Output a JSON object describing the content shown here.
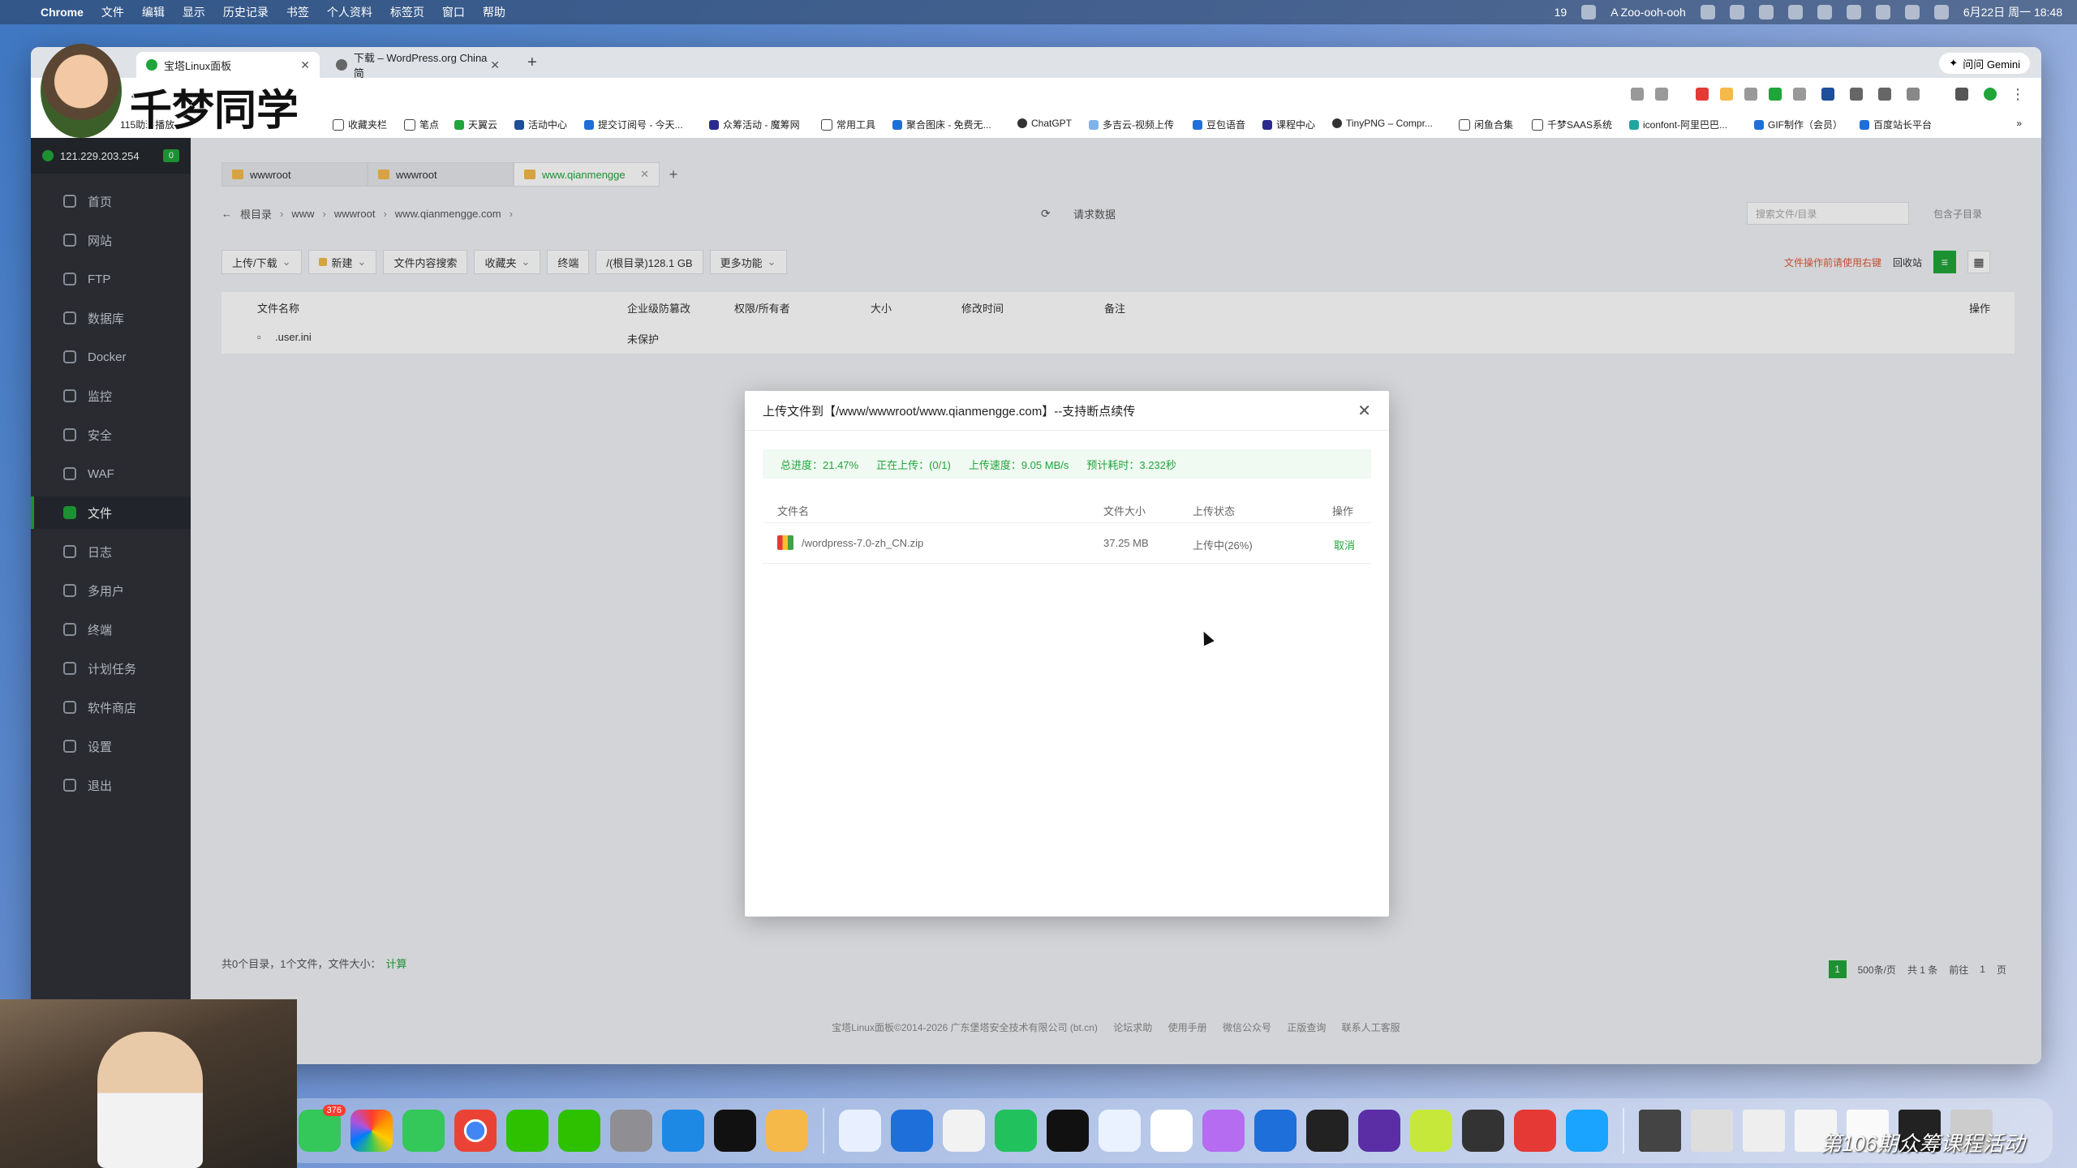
{
  "menubar": {
    "app": "Chrome",
    "items": [
      "文件",
      "编辑",
      "显示",
      "历史记录",
      "书签",
      "个人资料",
      "标签页",
      "窗口",
      "帮助"
    ],
    "right": {
      "badge": "19",
      "song": "A Zoo-ooh-ooh",
      "datetime": "6月22日 周一 18:48"
    }
  },
  "browser": {
    "tabs": [
      {
        "title": "宝塔Linux面板",
        "active": true
      },
      {
        "title": "下载 – WordPress.org China 简",
        "active": false
      }
    ],
    "gemini": "问问 Gemini",
    "bookmarks": [
      "115助理播放",
      "收藏夹栏",
      "笔点",
      "天翼云",
      "活动中心",
      "提交订阅号 - 今天...",
      "众筹活动 - 魔筹网",
      "常用工具",
      "聚合图床 - 免费无...",
      "ChatGPT",
      "多吉云-视频上传",
      "豆包语音",
      "课程中心",
      "TinyPNG – Compr...",
      "闲鱼合集",
      "千梦SAAS系统",
      "iconfont-阿里巴巴...",
      "GIF制作（会员）",
      "百度站长平台"
    ]
  },
  "panel": {
    "ip": "121.229.203.254",
    "ip_badge": "0",
    "nav": [
      {
        "label": "首页",
        "active": false
      },
      {
        "label": "网站",
        "active": false
      },
      {
        "label": "FTP",
        "active": false
      },
      {
        "label": "数据库",
        "active": false
      },
      {
        "label": "Docker",
        "active": false
      },
      {
        "label": "监控",
        "active": false
      },
      {
        "label": "安全",
        "active": false
      },
      {
        "label": "WAF",
        "active": false
      },
      {
        "label": "文件",
        "active": true
      },
      {
        "label": "日志",
        "active": false
      },
      {
        "label": "多用户",
        "active": false
      },
      {
        "label": "终端",
        "active": false
      },
      {
        "label": "计划任务",
        "active": false
      },
      {
        "label": "软件商店",
        "active": false
      },
      {
        "label": "设置",
        "active": false
      },
      {
        "label": "退出",
        "active": false
      }
    ],
    "file_tabs": [
      "wwwroot",
      "wwwroot",
      "www.qianmengge"
    ],
    "breadcrumb": [
      "根目录",
      "www",
      "wwwroot",
      "www.qianmengge.com"
    ],
    "request_data": "请求数据",
    "search_placeholder": "搜索文件/目录",
    "subdir": "包含子目录",
    "actions": [
      "上传/下载",
      "新建",
      "文件内容搜索",
      "收藏夹",
      "终端",
      "/(根目录)128.1 GB",
      "更多功能"
    ],
    "right_actions": {
      "warn": "文件操作前请使用右键",
      "recycle": "回收站"
    },
    "columns": [
      "文件名称",
      "企业级防篡改",
      "权限/所有者",
      "大小",
      "修改时间",
      "备注",
      "操作"
    ],
    "rows": [
      {
        "name": ".user.ini",
        "protect": "未保护"
      }
    ],
    "footer": {
      "summary": "共0个目录，1个文件，文件大小：",
      "calc": "计算",
      "page": "1",
      "per_page": "500条/页",
      "total": "共 1 条",
      "goto": "前往",
      "goto_page": "1",
      "page_unit": "页"
    },
    "copyright": "宝塔Linux面板©2014-2026 广东堡塔安全技术有限公司 (bt.cn)",
    "links": [
      "论坛求助",
      "使用手册",
      "微信公众号",
      "正版查询",
      "联系人工客服"
    ]
  },
  "modal": {
    "title": "上传文件到【/www/wwwroot/www.qianmengge.com】--支持断点续传",
    "progress": {
      "total": "总进度：21.47%",
      "uploading": "正在上传：(0/1)",
      "speed": "上传速度：9.05 MB/s",
      "eta": "预计耗时：3.232秒"
    },
    "columns": [
      "文件名",
      "文件大小",
      "上传状态",
      "操作"
    ],
    "file": {
      "name": "/wordpress-7.0-zh_CN.zip",
      "size": "37.25 MB",
      "status": "上传中(26%)",
      "action": "取消"
    }
  },
  "overlay": {
    "logo_text": "千梦同学",
    "promo": "第106期众筹课程活动"
  },
  "dock": {
    "messages_badge": "376"
  }
}
